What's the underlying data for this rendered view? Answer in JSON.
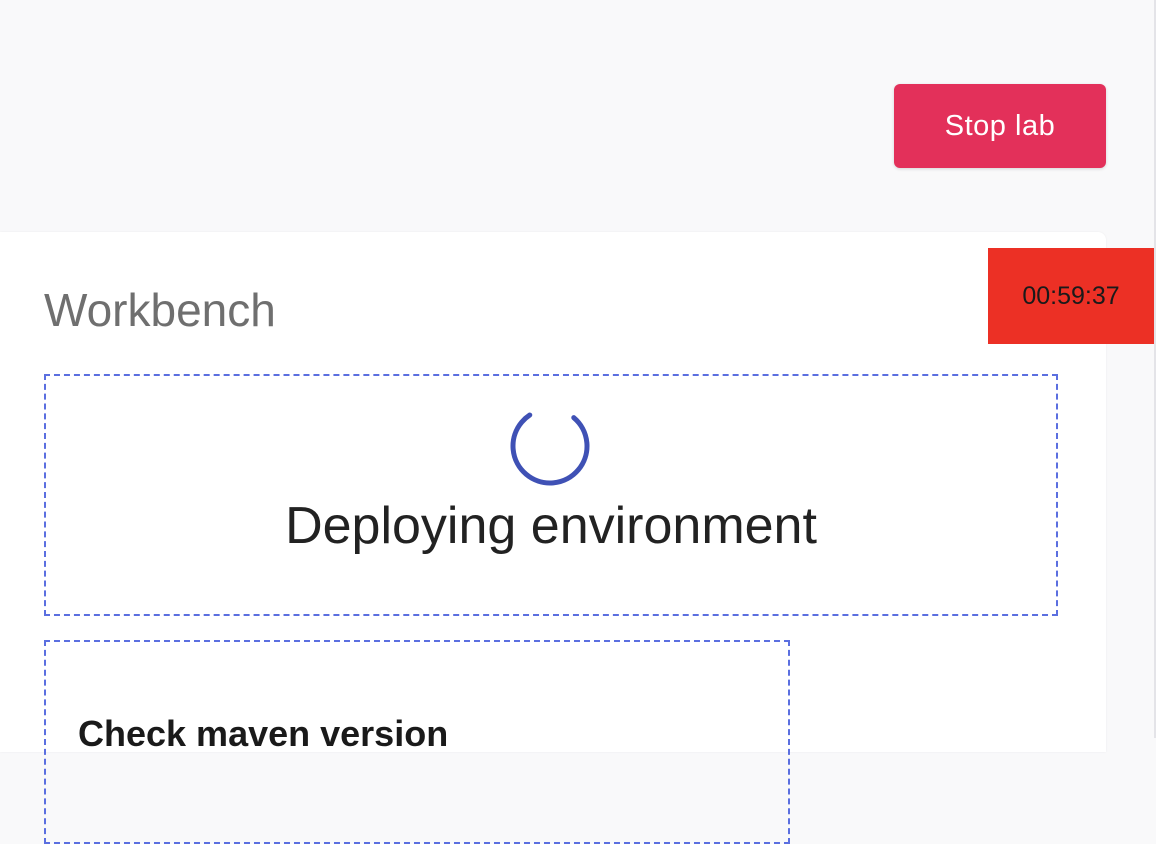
{
  "header": {
    "stop_label": "Stop lab"
  },
  "timer": {
    "value": "00:59:37"
  },
  "workbench": {
    "title": "Workbench",
    "status_text": "Deploying environment",
    "step_title": "Check maven version"
  },
  "colors": {
    "stop_button": "#e3305a",
    "timer_bg": "#ec3025",
    "spinner": "#3f51b5",
    "dashed_border": "#5b6fe0"
  },
  "icons": {
    "spinner": "loading-spinner-icon"
  }
}
